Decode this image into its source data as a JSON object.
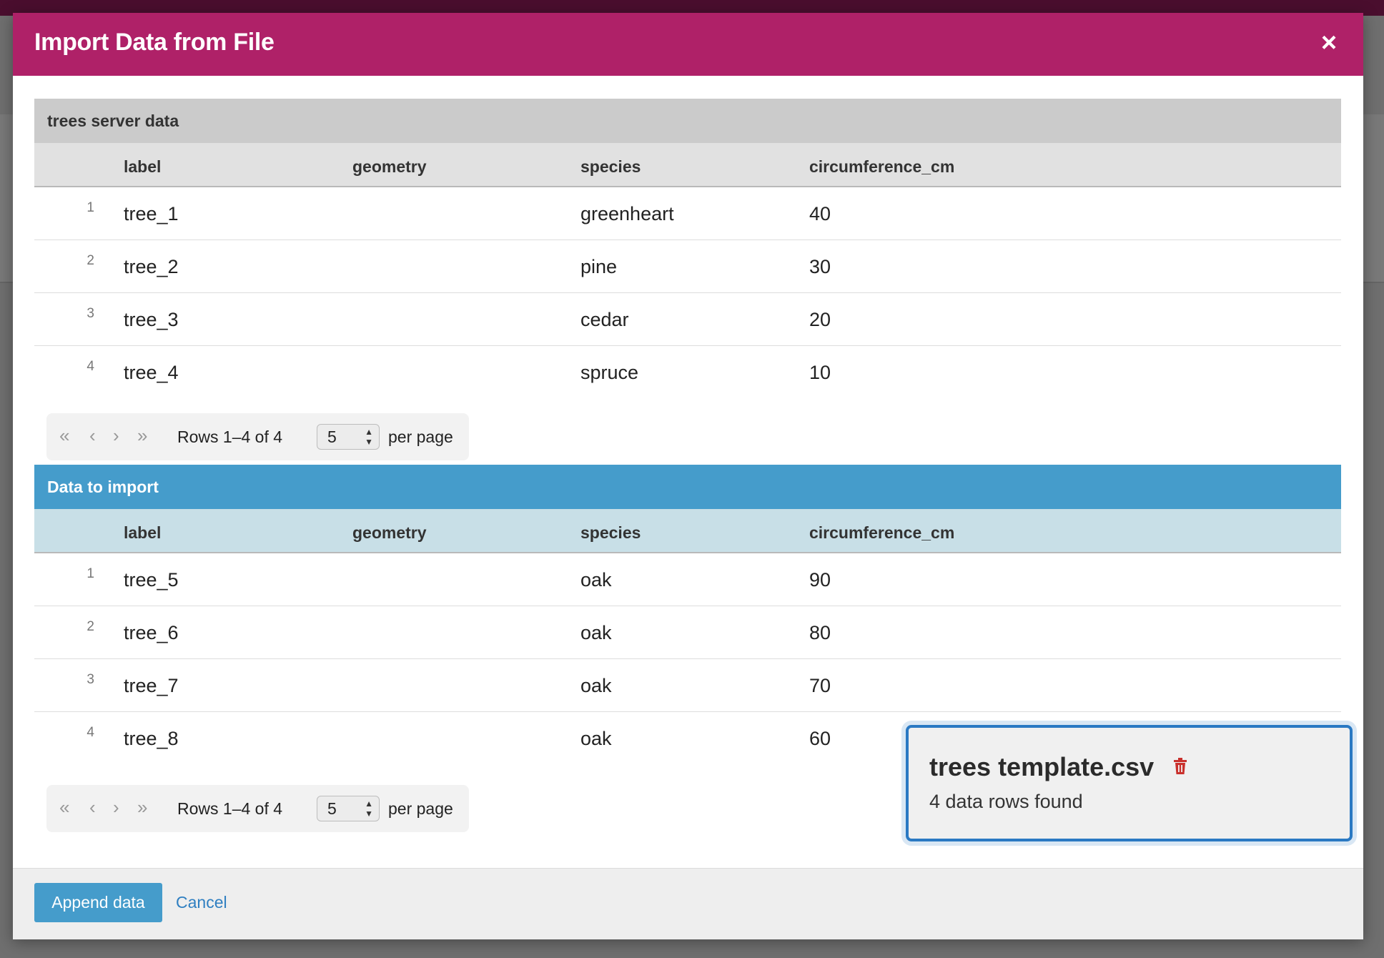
{
  "modal": {
    "title": "Import Data from File",
    "close_label": "×"
  },
  "columns": [
    "label",
    "geometry",
    "species",
    "circumference_cm"
  ],
  "server_section": {
    "title": "trees server data",
    "rows": [
      {
        "num": "1",
        "label": "tree_1",
        "geometry": "",
        "species": "greenheart",
        "circumference_cm": "40"
      },
      {
        "num": "2",
        "label": "tree_2",
        "geometry": "",
        "species": "pine",
        "circumference_cm": "30"
      },
      {
        "num": "3",
        "label": "tree_3",
        "geometry": "",
        "species": "cedar",
        "circumference_cm": "20"
      },
      {
        "num": "4",
        "label": "tree_4",
        "geometry": "",
        "species": "spruce",
        "circumference_cm": "10"
      }
    ],
    "pager": {
      "rows_text": "Rows 1–4 of 4",
      "per_page_value": "5",
      "per_page_label": "per page"
    }
  },
  "import_section": {
    "title": "Data to import",
    "rows": [
      {
        "num": "1",
        "label": "tree_5",
        "geometry": "",
        "species": "oak",
        "circumference_cm": "90"
      },
      {
        "num": "2",
        "label": "tree_6",
        "geometry": "",
        "species": "oak",
        "circumference_cm": "80"
      },
      {
        "num": "3",
        "label": "tree_7",
        "geometry": "",
        "species": "oak",
        "circumference_cm": "70"
      },
      {
        "num": "4",
        "label": "tree_8",
        "geometry": "",
        "species": "oak",
        "circumference_cm": "60"
      }
    ],
    "pager": {
      "rows_text": "Rows 1–4 of 4",
      "per_page_value": "5",
      "per_page_label": "per page"
    }
  },
  "file_card": {
    "file_name": "trees template.csv",
    "row_count_text": "4 data rows found",
    "delete_icon": "trash-icon"
  },
  "pager_icons": [
    "first-page-icon",
    "prev-page-icon",
    "next-page-icon",
    "last-page-icon"
  ],
  "footer": {
    "append_label": "Append data",
    "cancel_label": "Cancel"
  },
  "colors": {
    "header": "#af2168",
    "import_accent": "#459ccb",
    "focus_border": "#2a79c3",
    "delete_red": "#c9302c",
    "link": "#2f7fc1"
  }
}
